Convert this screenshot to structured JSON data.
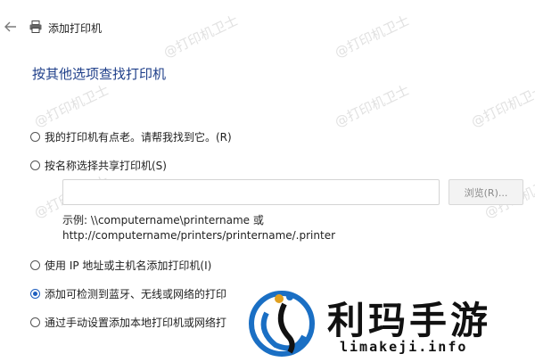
{
  "window": {
    "title": "添加打印机"
  },
  "heading": "按其他选项查找打印机",
  "options": [
    {
      "label": "我的打印机有点老。请帮我找到它。(R)",
      "checked": false
    },
    {
      "label": "按名称选择共享打印机(S)",
      "checked": false
    },
    {
      "label": "使用 IP 地址或主机名添加打印机(I)",
      "checked": false
    },
    {
      "label": "添加可检测到蓝牙、无线或网络的打印",
      "checked": true
    },
    {
      "label": "通过手动设置添加本地打印机或网络打",
      "checked": false
    }
  ],
  "share": {
    "input_value": "",
    "browse_label": "浏览(R)...",
    "example_line1": "示例: \\\\computername\\printername 或",
    "example_line2": "http://computername/printers/printername/.printer"
  },
  "watermark_text": "@打印机卫士",
  "brand": {
    "name": "利玛手游",
    "url": "limakeji.info",
    "colors": {
      "primary": "#1a6fc4",
      "dark": "#111111"
    }
  },
  "icons": {
    "back": "back-arrow-icon",
    "printer": "printer-icon"
  }
}
